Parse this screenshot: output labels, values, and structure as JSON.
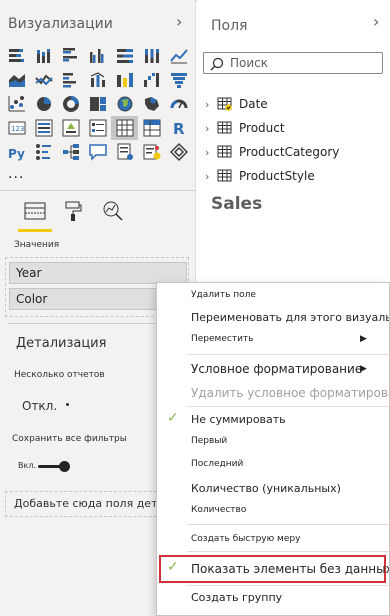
{
  "visualizations": {
    "title": "Визуализации",
    "more": "...",
    "tabs": [
      "fields-tab-icon",
      "format-paint-roller-icon",
      "analytics-magnifier-icon"
    ],
    "values_label": "Значения",
    "wells": [
      "Year",
      "Color"
    ],
    "drillthrough": {
      "title": "Детализация",
      "cross_report_label": "Несколько отчетов",
      "cross_report_value": "Откл.",
      "keep_filters_label": "Сохранить все фильтры",
      "keep_filters_value": "Вкл.",
      "drop_zone_placeholder": "Добавьте сюда поля детализации"
    }
  },
  "fields": {
    "title": "Поля",
    "search_placeholder": "Поиск",
    "tables": [
      "Date",
      "Product",
      "ProductCategory",
      "ProductStyle"
    ],
    "group_title": "Sales"
  },
  "context_menu": {
    "remove_field": "Удалить поле",
    "rename": "Переименовать для этого визуального",
    "move": "Переместить",
    "conditional_formatting": "Условное форматирование",
    "remove_conditional_formatting": "Удалить условное форматировани",
    "dont_summarize": "Не суммировать",
    "first": "Первый",
    "last": "Последний",
    "count_distinct": "Количество (уникальных)",
    "count": "Количество",
    "new_quick_measure": "Создать быструю меру",
    "show_items_no_data": "Показать элементы без данных",
    "new_group": "Создать группу"
  },
  "colors": {
    "accent_yellow": "#f2c811",
    "check_green": "#8ab84a",
    "highlight_red": "#d13438"
  }
}
